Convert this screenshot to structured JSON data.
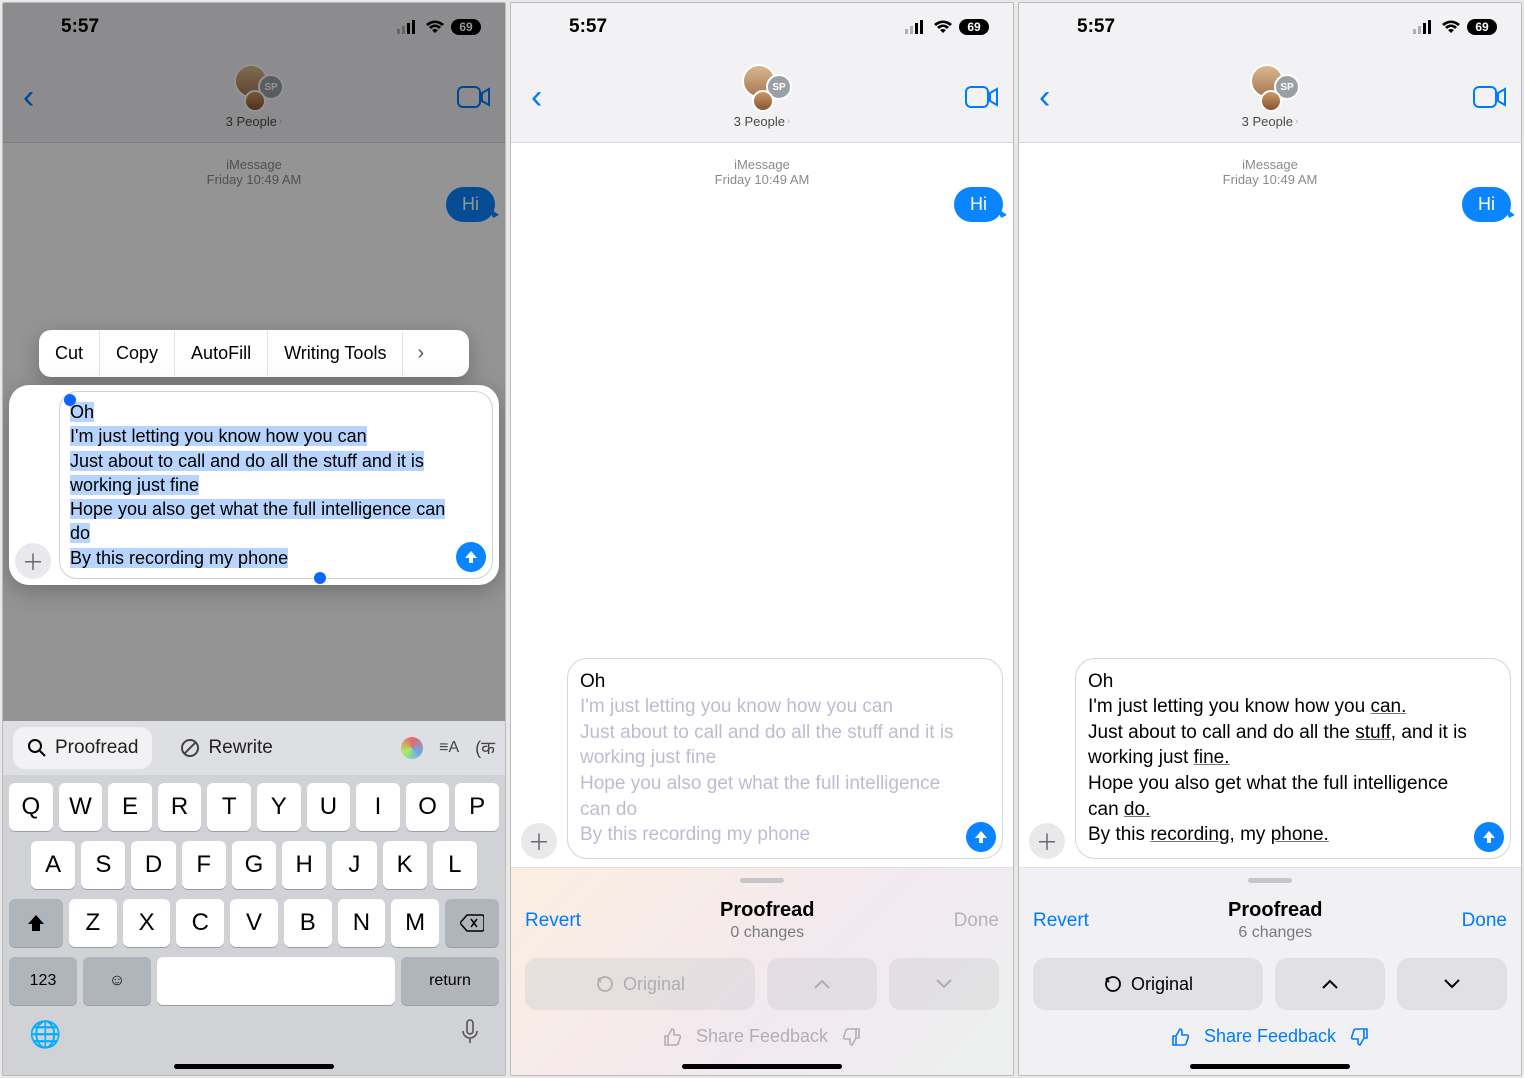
{
  "status": {
    "time": "5:57",
    "battery": "69"
  },
  "header": {
    "title": "3 People",
    "sp_initials": "SP"
  },
  "meta": {
    "service": "iMessage",
    "timestamp": "Friday 10:49 AM"
  },
  "bubble_out": "Hi",
  "compose_text": {
    "line1": "Oh",
    "line2": "I'm just letting you know how you can",
    "line3": "Just about to call and do all the stuff and it is working just fine",
    "line4": "Hope you also get what the full intelligence can do",
    "line5": "By this recording my phone"
  },
  "compose_result": {
    "line1": "Oh",
    "p2a": "I'm just letting you know how you ",
    "p2u": "can.",
    "p3a": "Just about to call and do all the ",
    "p3u": "stuff,",
    "p3b": " and it is working just ",
    "p3u2": "fine.",
    "p4a": "Hope you also get what the full intelligence can ",
    "p4u": "do.",
    "p5a": "By this ",
    "p5u": "recording,",
    "p5b": " my ",
    "p5u2": "phone."
  },
  "edit_menu": {
    "cut": "Cut",
    "copy": "Copy",
    "autofill": "AutoFill",
    "writing": "Writing Tools"
  },
  "toolbar": {
    "proofread": "Proofread",
    "rewrite": "Rewrite"
  },
  "keys": {
    "row1": [
      "Q",
      "W",
      "E",
      "R",
      "T",
      "Y",
      "U",
      "I",
      "O",
      "P"
    ],
    "row2": [
      "A",
      "S",
      "D",
      "F",
      "G",
      "H",
      "J",
      "K",
      "L"
    ],
    "row3": [
      "Z",
      "X",
      "C",
      "V",
      "B",
      "N",
      "M"
    ],
    "num": "123",
    "return": "return"
  },
  "proof": {
    "revert": "Revert",
    "done": "Done",
    "title": "Proofread",
    "changes0": "0 changes",
    "changes6": "6 changes",
    "original": "Original",
    "share": "Share Feedback"
  }
}
